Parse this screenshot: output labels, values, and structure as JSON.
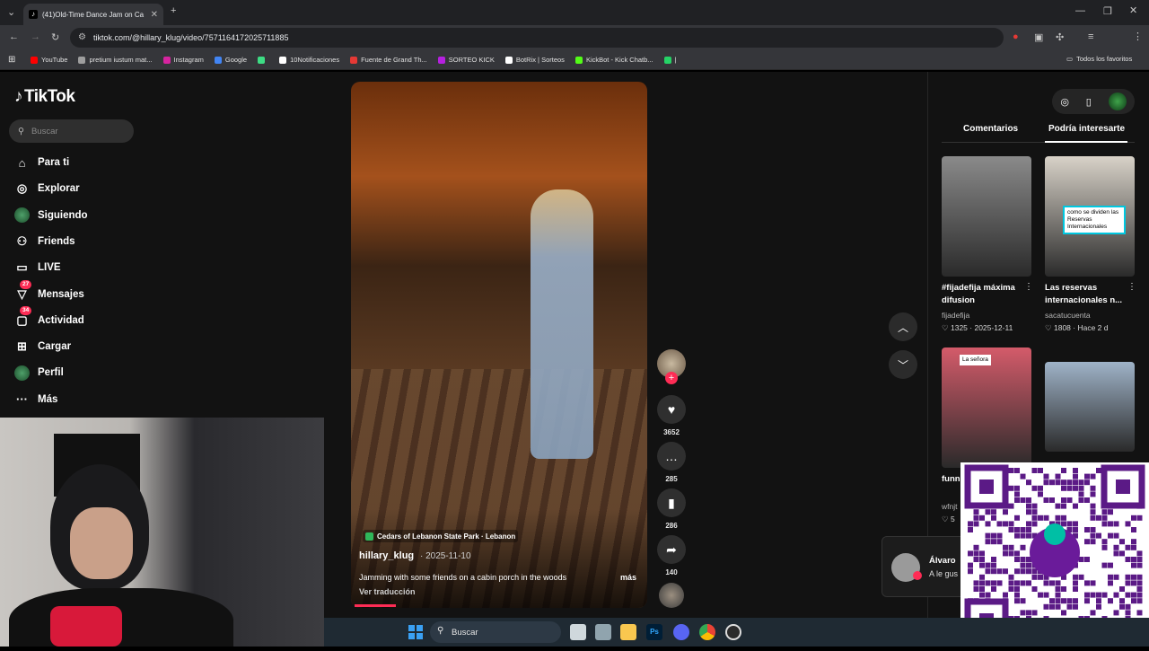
{
  "browser": {
    "tab_title": "(41)Old-Time Dance Jam on Ca",
    "url": "tiktok.com/@hillary_klug/video/7571164172025711885",
    "bookmarks": [
      {
        "label": "YouTube",
        "color": "#ff0000"
      },
      {
        "label": "pretium iustum mat...",
        "color": "#9e9e9e"
      },
      {
        "label": "Instagram",
        "color": "#d6249f"
      },
      {
        "label": "Google",
        "color": "#4285f4"
      },
      {
        "label": "",
        "color": "#3ddc84"
      },
      {
        "label": "10Notificaciones",
        "color": "#ffffff"
      },
      {
        "label": "Fuente de Grand Th...",
        "color": "#e53935"
      },
      {
        "label": "SORTEO KICK",
        "color": "#b620e0"
      },
      {
        "label": "BotRix | Sorteos",
        "color": "#ffffff"
      },
      {
        "label": "KickBot - Kick Chatb...",
        "color": "#53fc18"
      },
      {
        "label": "|",
        "color": "#25d366"
      }
    ],
    "all_favorites": "Todos los favoritos"
  },
  "tiktok": {
    "logo": "TikTok",
    "search_placeholder": "Buscar",
    "nav": [
      {
        "label": "Para ti",
        "icon": "home-icon",
        "glyph": "⌂",
        "badge": ""
      },
      {
        "label": "Explorar",
        "icon": "compass-icon",
        "glyph": "◎",
        "badge": ""
      },
      {
        "label": "Siguiendo",
        "icon": "following-avatar-icon",
        "glyph": "●",
        "badge": ""
      },
      {
        "label": "Friends",
        "icon": "friends-icon",
        "glyph": "⚇",
        "badge": ""
      },
      {
        "label": "LIVE",
        "icon": "live-icon",
        "glyph": "▭",
        "badge": ""
      },
      {
        "label": "Mensajes",
        "icon": "messages-icon",
        "glyph": "▽",
        "badge": "27"
      },
      {
        "label": "Actividad",
        "icon": "activity-icon",
        "glyph": "▢",
        "badge": "34"
      },
      {
        "label": "Cargar",
        "icon": "upload-icon",
        "glyph": "⊞",
        "badge": ""
      },
      {
        "label": "Perfil",
        "icon": "profile-avatar-icon",
        "glyph": "●",
        "badge": ""
      },
      {
        "label": "Más",
        "icon": "more-icon",
        "glyph": "···",
        "badge": ""
      }
    ]
  },
  "video": {
    "location": "Cedars of Lebanon State Park · Lebanon",
    "author": "hillary_klug",
    "date": "· 2025-11-10",
    "caption": "Jamming with some friends on a cabin porch in the woods",
    "more": "más",
    "translate": "Ver traducción",
    "progress": 0.14,
    "likes": "3652",
    "comments": "285",
    "saves": "286",
    "shares": "140"
  },
  "right_panel": {
    "tabs": [
      "Comentarios",
      "Podría interesarte"
    ],
    "active_tab": 1,
    "items": [
      {
        "title": "#fijadefija máxima difusion",
        "author": "fijadefija",
        "likes": "1325",
        "date": "2025-12-11",
        "thumb_color": "#8a8a8a",
        "overlay": ""
      },
      {
        "title": "Las reservas internacionales n...",
        "author": "sacatucuenta",
        "likes": "1808",
        "date": "Hace 2 d",
        "thumb_color": "#d8d2c8",
        "overlay": "como se dividen las Reservas Internacionales"
      },
      {
        "title": "funn #for",
        "author": "wfnjt",
        "likes": "5",
        "date": "",
        "thumb_color": "#d45b6a",
        "overlay": "La señora"
      },
      {
        "title": "",
        "author": "",
        "likes": "",
        "date": "",
        "thumb_color": "#9fb3c8",
        "overlay": ""
      }
    ]
  },
  "notification": {
    "name": "Álvaro",
    "message": "A le gus"
  },
  "taskbar": {
    "search_label": "Buscar"
  }
}
